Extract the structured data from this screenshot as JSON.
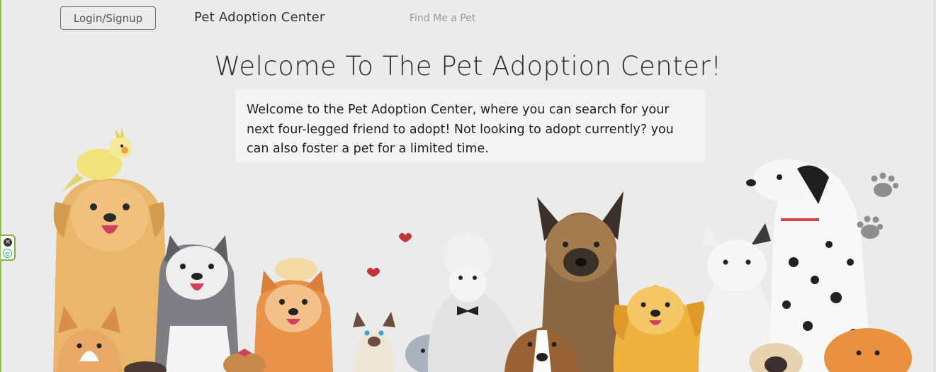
{
  "nav": {
    "login_label": "Login/Signup",
    "brand": "Pet Adoption Center",
    "find_link": "Find Me a Pet"
  },
  "hero": {
    "title": "Welcome To The Pet Adoption Center!",
    "intro": "Welcome to the Pet Adoption Center, where you can search for your next four-legged friend to adopt! Not looking to adopt currently? you can also foster a pet for a limited time."
  },
  "colors": {
    "background": "#ebebeb",
    "intro_box": "#f4f4f4",
    "widget_accent": "#7cb342"
  },
  "icons": {
    "widget_close": "close-icon",
    "widget_ext": "extension-e-icon",
    "paw": "paw-print-icon",
    "heart": "heart-icon"
  }
}
